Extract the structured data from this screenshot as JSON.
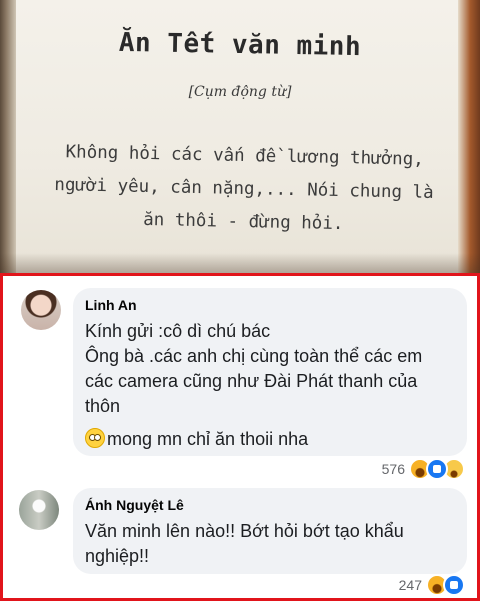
{
  "book": {
    "title": "Ăn Tết văn minh",
    "subtitle": "[Cụm động từ]",
    "body": "Không hỏi các vấn đề lương thưởng, người yêu, cân nặng,... Nói chung là ăn thôi - đừng hỏi."
  },
  "comments": [
    {
      "author": "Linh An",
      "lines": [
        "Kính gửi :cô dì chú bác",
        "Ông bà .các anh chị cùng toàn thể các em các camera cũng như Đài Phát thanh của thôn"
      ],
      "emoji_line": "mong mn chỉ ăn thoii nha",
      "emoji_icon": "rolling-eyes-emoji",
      "reaction_count": "576",
      "reactions": [
        "haha",
        "like",
        "sad"
      ]
    },
    {
      "author": "Ánh Nguyệt Lê",
      "lines": [
        "Văn minh lên nào!!  Bớt hỏi bớt tạo khẩu nghiệp!!"
      ],
      "reaction_count": "247",
      "reactions": [
        "haha",
        "like"
      ]
    }
  ],
  "colors": {
    "frame": "#e1141b",
    "bubble": "#f0f2f5",
    "like": "#1877f2",
    "haha": "#f7b125"
  }
}
